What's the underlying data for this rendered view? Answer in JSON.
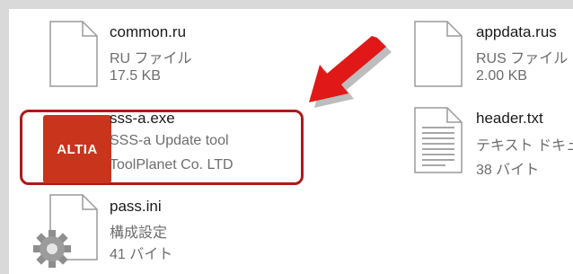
{
  "files": [
    {
      "name": "common.ru",
      "type": "RU ファイル",
      "info": "17.5 KB",
      "icon": "blank-file-icon"
    },
    {
      "name": "appdata.rus",
      "type": "RUS ファイル",
      "info": "2.00 KB",
      "icon": "blank-file-icon"
    },
    {
      "name": "sss-a.exe",
      "type": "SSS-a Update tool",
      "info": "ToolPlanet Co. LTD",
      "icon": "altia-app-icon",
      "icon_text": "ALTIA"
    },
    {
      "name": "header.txt",
      "type": "テキスト ドキュメ",
      "info": "38 バイト",
      "icon": "text-document-icon"
    },
    {
      "name": "pass.ini",
      "type": "構成設定",
      "info": "41 バイト",
      "icon": "config-gear-file-icon"
    }
  ],
  "colors": {
    "highlight": "#b01818",
    "arrow": "#e01818",
    "app_icon_bg": "#c9341c"
  }
}
